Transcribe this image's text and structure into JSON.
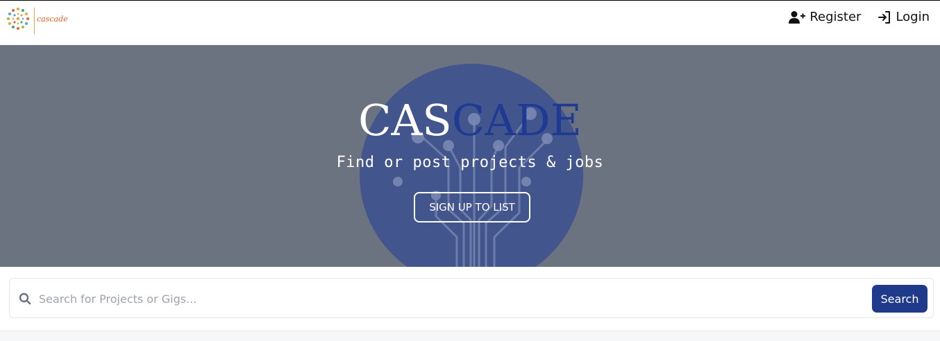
{
  "brand": {
    "logo_text": "cascade"
  },
  "nav": {
    "register_label": "Register",
    "login_label": "Login"
  },
  "hero": {
    "title_part1": "CAS",
    "title_part2": "CADE",
    "subtitle": "Find or post projects & jobs",
    "cta_label": "SIGN UP TO LIST"
  },
  "search": {
    "placeholder": "Search for Projects or Gigs...",
    "value": "",
    "button_label": "Search"
  },
  "colors": {
    "brand_blue": "#1f3a93",
    "button_blue": "#1f3a8a",
    "hero_bg": "#6b7280",
    "hero_circle": "#42558d"
  }
}
